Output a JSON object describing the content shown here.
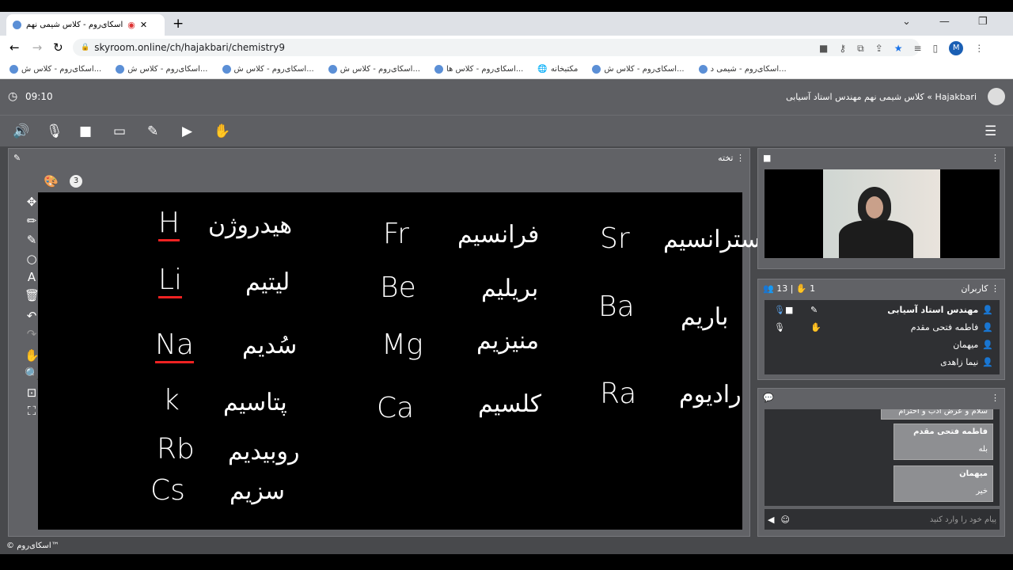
{
  "browser": {
    "tab_title": "اسکای‌روم - کلاس شیمی نهم",
    "url": "skyroom.online/ch/hajakbari/chemistry9",
    "profile_initial": "M",
    "bookmarks": [
      "اسکای‌روم - کلاس ش...",
      "اسکای‌روم - کلاس ش...",
      "اسکای‌روم - کلاس ش...",
      "اسکای‌روم - کلاس ش...",
      "اسکای‌روم - کلاس ها...",
      "مکتبخانه",
      "اسکای‌روم - کلاس ش...",
      "اسکای‌روم - شیمی د..."
    ]
  },
  "header": {
    "time": "09:10",
    "breadcrumb": "Hajakbari » کلاس شیمی نهم مهندس استاد آسیابی"
  },
  "toolbar": [
    "speaker-icon",
    "mic-icon",
    "camera-icon",
    "screen-share-icon",
    "pen-icon",
    "media-icon",
    "raise-hand-icon"
  ],
  "board": {
    "title": "تخته",
    "page": "3",
    "col1": [
      {
        "sym": "H",
        "name": "هیدروژن"
      },
      {
        "sym": "Li",
        "name": "لیتیم"
      },
      {
        "sym": "Na",
        "name": "سُدیم"
      },
      {
        "sym": "k",
        "name": "پتاسیم"
      },
      {
        "sym": "Rb",
        "name": "روبیدیم"
      },
      {
        "sym": "Cs",
        "name": "سزیم"
      }
    ],
    "col2": [
      {
        "sym": "Fr",
        "name": "فرانسیم"
      },
      {
        "sym": "Be",
        "name": "بریلیم"
      },
      {
        "sym": "Mg",
        "name": "منیزیم"
      },
      {
        "sym": "Ca",
        "name": "کلسیم"
      }
    ],
    "col3": [
      {
        "sym": "Sr",
        "name": "استرانسیم"
      },
      {
        "sym": "Ba",
        "name": "باریم"
      },
      {
        "sym": "Ra",
        "name": "رادیوم"
      }
    ]
  },
  "users": {
    "title": "کاربران",
    "count": "13",
    "hands": "1",
    "list": [
      "مهندس استاد آسیابی",
      "فاطمه فتحی مقدم",
      "میهمان",
      "نیما زاهدی"
    ]
  },
  "chat": {
    "messages": [
      {
        "text": "سلام و عرض ادب و احترام"
      },
      {
        "author": "فاطمه فتحی مقدم",
        "text": "بله"
      },
      {
        "author": "میهمان",
        "text": "خیر"
      }
    ],
    "placeholder": "پیام خود را وارد کنید"
  },
  "footer": "© اسکای‌روم™"
}
